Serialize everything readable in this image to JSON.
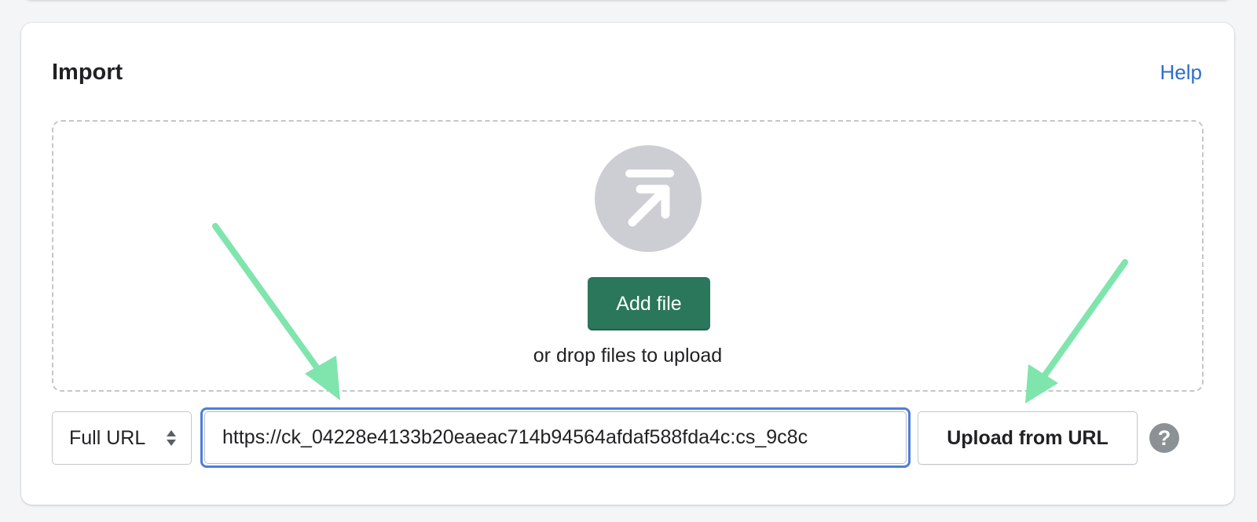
{
  "import_card": {
    "title": "Import",
    "help_link": "Help",
    "dropzone": {
      "icon": "upload-arrow-icon",
      "add_file_label": "Add file",
      "hint": "or drop files to upload"
    },
    "url_type_select": {
      "selected": "Full URL",
      "icon": "select-chevron-icon"
    },
    "url_input": {
      "value": "https://ck_04228e4133b20eaeac714b94564afdaf588fda4c:cs_9c8c"
    },
    "upload_url_label": "Upload from URL",
    "help_icon": "?"
  },
  "colors": {
    "primary_button": "#2a775b",
    "link": "#2c6ecb",
    "focus_ring": "#4d7fd8",
    "annotation_arrow": "#7fe5ad",
    "icon_circle": "#ccced4"
  }
}
